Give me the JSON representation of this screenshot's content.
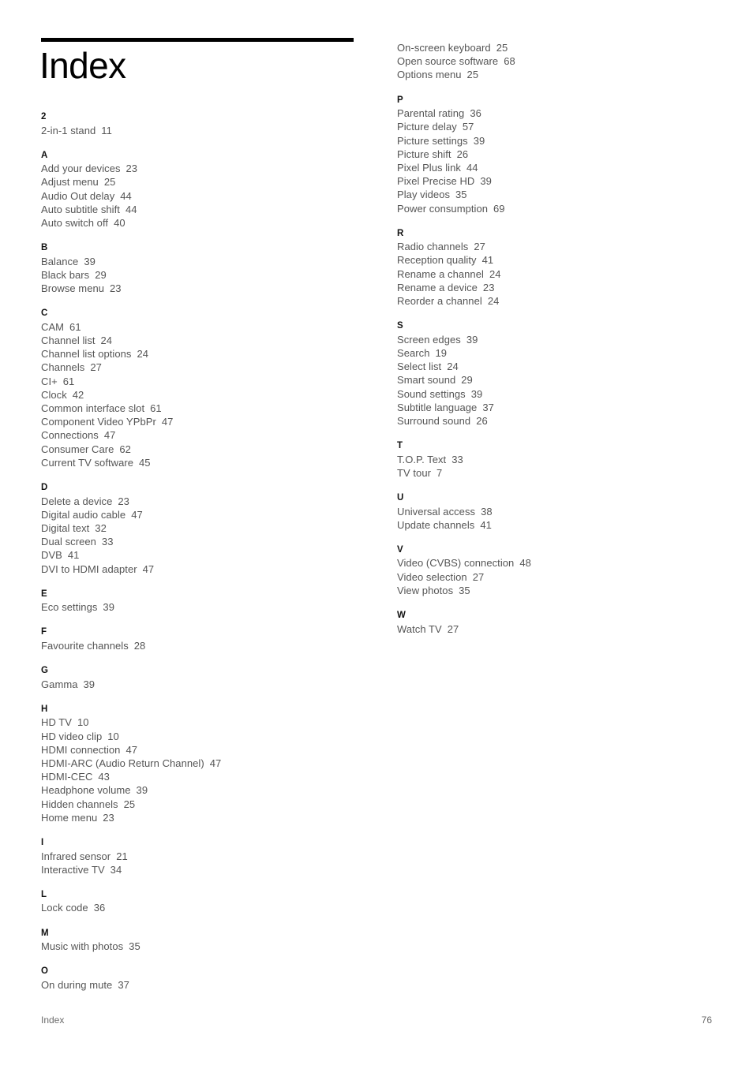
{
  "document": {
    "title": "Index",
    "footer_label": "Index",
    "footer_page_number": "76",
    "rule_color": "#000000",
    "title_color": "#000000",
    "entry_color": "#555555",
    "letter_color": "#111111",
    "background_color": "#ffffff"
  },
  "columns": [
    {
      "id": "left",
      "groups": [
        {
          "letter": "2",
          "entries": [
            {
              "term": "2-in-1 stand",
              "page": "11"
            }
          ]
        },
        {
          "letter": "A",
          "entries": [
            {
              "term": "Add your devices",
              "page": "23"
            },
            {
              "term": "Adjust menu",
              "page": "25"
            },
            {
              "term": "Audio Out delay",
              "page": "44"
            },
            {
              "term": "Auto subtitle shift",
              "page": "44"
            },
            {
              "term": "Auto switch off",
              "page": "40"
            }
          ]
        },
        {
          "letter": "B",
          "entries": [
            {
              "term": "Balance",
              "page": "39"
            },
            {
              "term": "Black bars",
              "page": "29"
            },
            {
              "term": "Browse menu",
              "page": "23"
            }
          ]
        },
        {
          "letter": "C",
          "entries": [
            {
              "term": "CAM",
              "page": "61"
            },
            {
              "term": "Channel list",
              "page": "24"
            },
            {
              "term": "Channel list options",
              "page": "24"
            },
            {
              "term": "Channels",
              "page": "27"
            },
            {
              "term": "CI+",
              "page": "61"
            },
            {
              "term": "Clock",
              "page": "42"
            },
            {
              "term": "Common interface slot",
              "page": "61"
            },
            {
              "term": "Component Video YPbPr",
              "page": "47"
            },
            {
              "term": "Connections",
              "page": "47"
            },
            {
              "term": "Consumer Care",
              "page": "62"
            },
            {
              "term": "Current TV software",
              "page": "45"
            }
          ]
        },
        {
          "letter": "D",
          "entries": [
            {
              "term": "Delete a device",
              "page": "23"
            },
            {
              "term": "Digital audio cable",
              "page": "47"
            },
            {
              "term": "Digital text",
              "page": "32"
            },
            {
              "term": "Dual screen",
              "page": "33"
            },
            {
              "term": "DVB",
              "page": "41"
            },
            {
              "term": "DVI to HDMI adapter",
              "page": "47"
            }
          ]
        },
        {
          "letter": "E",
          "entries": [
            {
              "term": "Eco settings",
              "page": "39"
            }
          ]
        },
        {
          "letter": "F",
          "entries": [
            {
              "term": "Favourite channels",
              "page": "28"
            }
          ]
        },
        {
          "letter": "G",
          "entries": [
            {
              "term": "Gamma",
              "page": "39"
            }
          ]
        },
        {
          "letter": "H",
          "entries": [
            {
              "term": "HD TV",
              "page": "10"
            },
            {
              "term": "HD video clip",
              "page": "10"
            },
            {
              "term": "HDMI connection",
              "page": "47"
            },
            {
              "term": "HDMI-ARC (Audio Return Channel)",
              "page": "47"
            },
            {
              "term": "HDMI-CEC",
              "page": "43"
            },
            {
              "term": "Headphone volume",
              "page": "39"
            },
            {
              "term": "Hidden channels",
              "page": "25"
            },
            {
              "term": "Home menu",
              "page": "23"
            }
          ]
        },
        {
          "letter": "I",
          "entries": [
            {
              "term": "Infrared sensor",
              "page": "21"
            },
            {
              "term": "Interactive TV",
              "page": "34"
            }
          ]
        },
        {
          "letter": "L",
          "entries": [
            {
              "term": "Lock code",
              "page": "36"
            }
          ]
        },
        {
          "letter": "M",
          "entries": [
            {
              "term": "Music with photos",
              "page": "35"
            }
          ]
        },
        {
          "letter": "O",
          "entries": [
            {
              "term": "On during mute",
              "page": "37"
            }
          ]
        }
      ]
    },
    {
      "id": "right",
      "groups": [
        {
          "letter": "",
          "continuation": true,
          "entries": [
            {
              "term": "On-screen keyboard",
              "page": "25"
            },
            {
              "term": "Open source software",
              "page": "68"
            },
            {
              "term": "Options menu",
              "page": "25"
            }
          ]
        },
        {
          "letter": "P",
          "entries": [
            {
              "term": "Parental rating",
              "page": "36"
            },
            {
              "term": "Picture delay",
              "page": "57"
            },
            {
              "term": "Picture settings",
              "page": "39"
            },
            {
              "term": "Picture shift",
              "page": "26"
            },
            {
              "term": "Pixel Plus link",
              "page": "44"
            },
            {
              "term": "Pixel Precise HD",
              "page": "39"
            },
            {
              "term": "Play videos",
              "page": "35"
            },
            {
              "term": "Power consumption",
              "page": "69"
            }
          ]
        },
        {
          "letter": "R",
          "entries": [
            {
              "term": "Radio channels",
              "page": "27"
            },
            {
              "term": "Reception quality",
              "page": "41"
            },
            {
              "term": "Rename a channel",
              "page": "24"
            },
            {
              "term": "Rename a device",
              "page": "23"
            },
            {
              "term": "Reorder a channel",
              "page": "24"
            }
          ]
        },
        {
          "letter": "S",
          "entries": [
            {
              "term": "Screen edges",
              "page": "39"
            },
            {
              "term": "Search",
              "page": "19"
            },
            {
              "term": "Select list",
              "page": "24"
            },
            {
              "term": "Smart sound",
              "page": "29"
            },
            {
              "term": "Sound settings",
              "page": "39"
            },
            {
              "term": "Subtitle language",
              "page": "37"
            },
            {
              "term": "Surround sound",
              "page": "26"
            }
          ]
        },
        {
          "letter": "T",
          "entries": [
            {
              "term": "T.O.P. Text",
              "page": "33"
            },
            {
              "term": "TV tour",
              "page": "7"
            }
          ]
        },
        {
          "letter": "U",
          "entries": [
            {
              "term": "Universal access",
              "page": "38"
            },
            {
              "term": "Update channels",
              "page": "41"
            }
          ]
        },
        {
          "letter": "V",
          "entries": [
            {
              "term": "Video (CVBS) connection",
              "page": "48"
            },
            {
              "term": "Video selection",
              "page": "27"
            },
            {
              "term": "View photos",
              "page": "35"
            }
          ]
        },
        {
          "letter": "W",
          "entries": [
            {
              "term": "Watch TV",
              "page": "27"
            }
          ]
        }
      ]
    }
  ]
}
